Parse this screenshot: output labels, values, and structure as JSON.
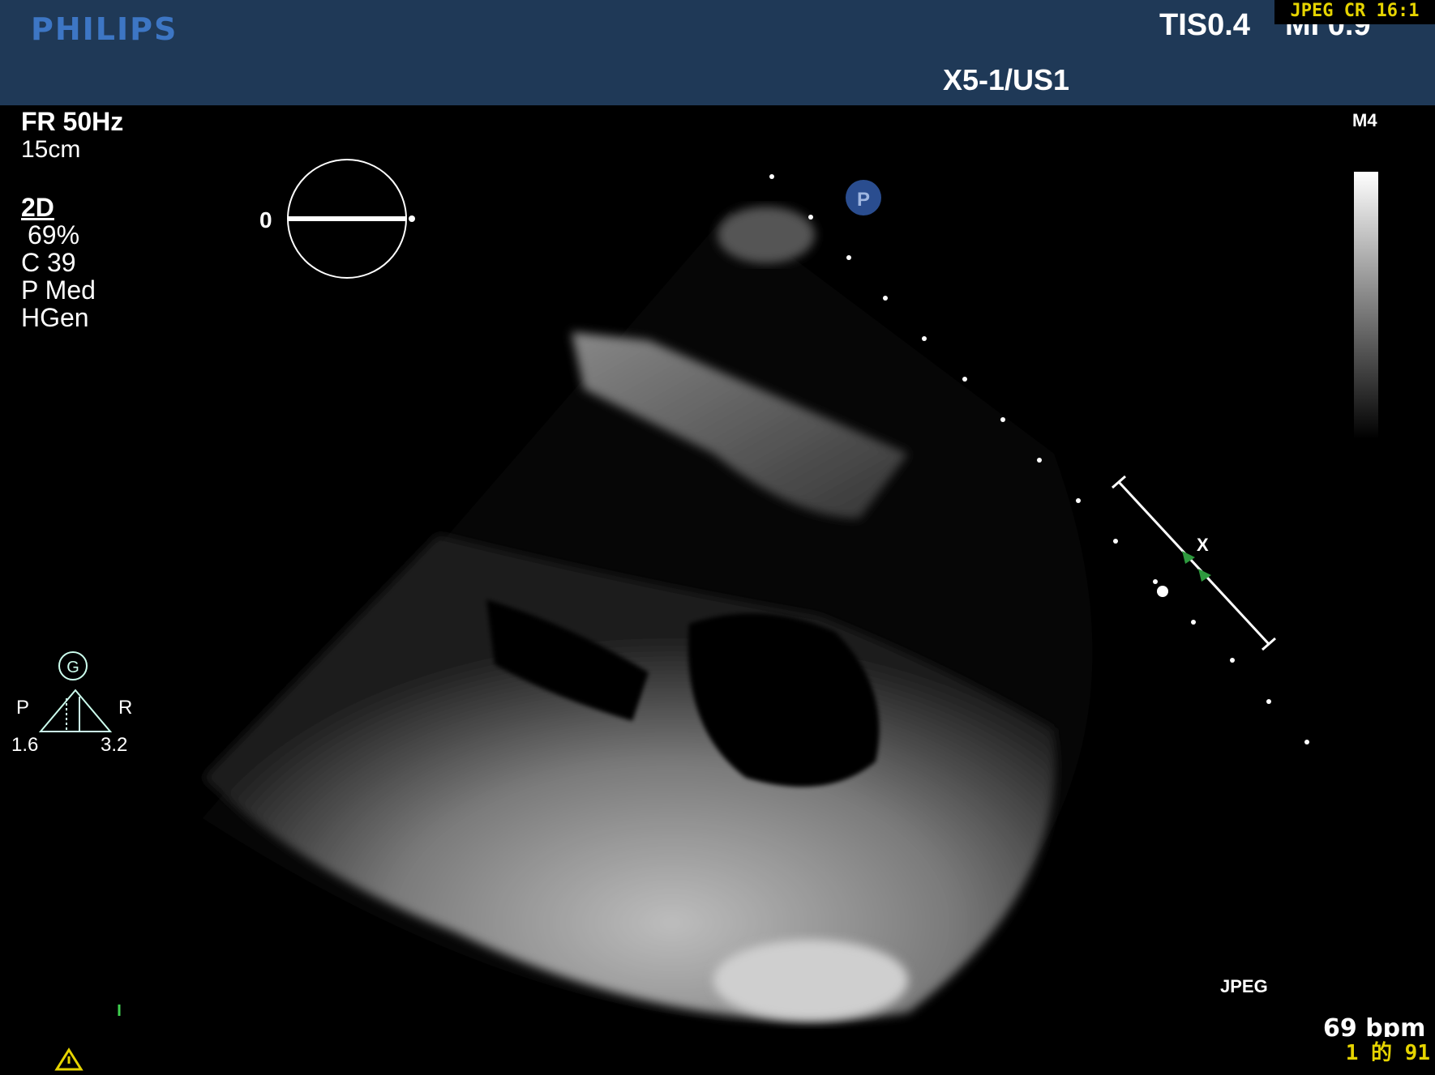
{
  "header": {
    "brand": "PHILIPS",
    "tis": "TIS0.4",
    "mi": "MI 0.9",
    "compression": "JPEG CR 16:1",
    "probe": "X5-1/US1"
  },
  "params": {
    "frame_rate": "FR 50Hz",
    "depth": "15cm",
    "mode": "2D",
    "gain": "69%",
    "compress": "C 39",
    "power": "P Med",
    "harmonics": "HGen"
  },
  "orientation": {
    "angle": "0"
  },
  "grayscale_map": "M4",
  "marker": "P",
  "focus_label": "X",
  "pr_indicator": {
    "glyph": "G",
    "left": "P",
    "right": "R",
    "left_value": "1.6",
    "right_value": "3.2"
  },
  "footer": {
    "format": "JPEG",
    "heart_rate": "69 bpm",
    "frame_index": "1 的 91"
  },
  "colors": {
    "header_bg": "#1f3957",
    "brand": "#3d76c4",
    "overlay_yellow": "#e6d400",
    "focus_green": "#2e9a3e"
  }
}
